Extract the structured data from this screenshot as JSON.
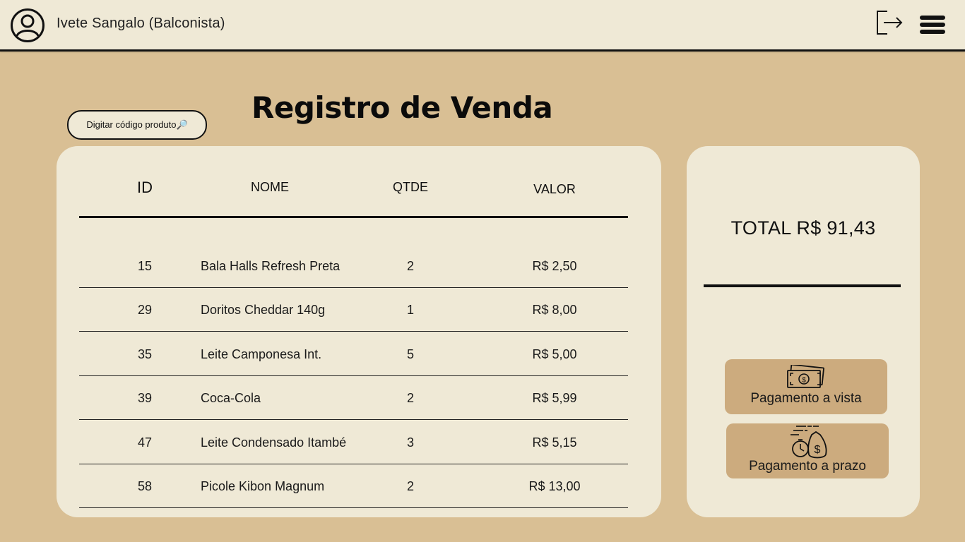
{
  "header": {
    "user_name": "Ivete Sangalo (Balconista)",
    "avatar_icon": "user-circle-icon",
    "logout_icon": "logout-icon",
    "menu_icon": "hamburger-menu-icon"
  },
  "search": {
    "label": "Digitar código produto🔎"
  },
  "page": {
    "title": "Registro de Venda"
  },
  "table": {
    "columns": {
      "id": "ID",
      "nome": "NOME",
      "qtde": "QTDE",
      "valor": "VALOR"
    },
    "rows": [
      {
        "id": "15",
        "nome": "Bala Halls Refresh Preta",
        "qtde": "2",
        "valor": "R$ 2,50"
      },
      {
        "id": "29",
        "nome": "Doritos Cheddar 140g",
        "qtde": "1",
        "valor": "R$ 8,00"
      },
      {
        "id": "35",
        "nome": "Leite Camponesa Int.",
        "qtde": "5",
        "valor": "R$ 5,00"
      },
      {
        "id": "39",
        "nome": "Coca-Cola",
        "qtde": "2",
        "valor": "R$ 5,99"
      },
      {
        "id": "47",
        "nome": "Leite Condensado Itambé",
        "qtde": "3",
        "valor": "R$ 5,15"
      },
      {
        "id": "58",
        "nome": "Picole Kibon Magnum",
        "qtde": "2",
        "valor": "R$ 13,00"
      }
    ]
  },
  "summary": {
    "total": "TOTAL R$ 91,43"
  },
  "payments": {
    "cash_label": "Pagamento a vista",
    "cash_icon": "cash-bill-icon",
    "term_label": "Pagamento a prazo",
    "term_icon": "money-bag-clock-icon"
  },
  "colors": {
    "background": "#d9bf94",
    "panel": "#efe9d6",
    "button": "#ccab7e",
    "ink": "#111111"
  }
}
